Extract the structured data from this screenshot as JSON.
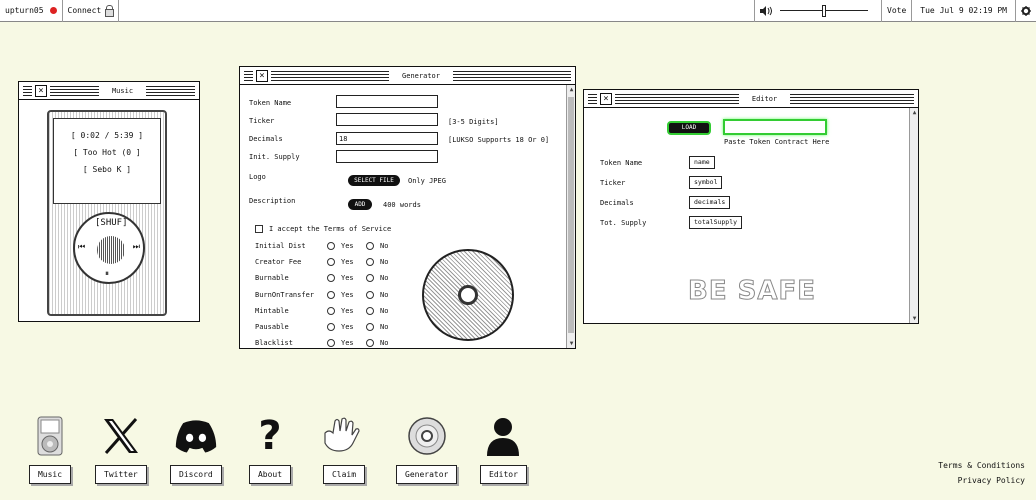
{
  "topbar": {
    "user": "upturn05",
    "connect_label": "Connect",
    "status_color": "#dd2222",
    "volume_level": 0.5,
    "vote_label": "Vote",
    "datetime": "Tue Jul 9 02:19 PM"
  },
  "music": {
    "title": "Music",
    "time": "[ 0:02 / 5:39 ]",
    "track": "[ Too Hot (0 ]",
    "artist": "[ Sebo K ]",
    "shuffle": "[SHUF]",
    "prev": "⏮",
    "next": "⏭",
    "pause": "⏸"
  },
  "generator": {
    "title": "Generator",
    "fields": [
      {
        "label": "Token Name",
        "value": "",
        "hint": ""
      },
      {
        "label": "Ticker",
        "value": "",
        "hint": "[3-5 Digits]"
      },
      {
        "label": "Decimals",
        "value": "18",
        "hint": "[LUKSO Supports 18 Or 0]"
      },
      {
        "label": "Init. Supply",
        "value": "",
        "hint": ""
      }
    ],
    "logo_label": "Logo",
    "select_file": "SELECT FILE",
    "logo_hint": "Only JPEG",
    "description_label": "Description",
    "add_label": "ADD",
    "description_hint": "400 words",
    "tos_label": "I accept the Terms of Service",
    "yes": "Yes",
    "no": "No",
    "options": [
      "Initial Dist",
      "Creator Fee",
      "Burnable",
      "BurnOnTransfer",
      "Mintable",
      "Pausable",
      "Blacklist"
    ]
  },
  "editor": {
    "title": "Editor",
    "load_label": "LOAD",
    "contract_value": "",
    "paste_hint": "Paste Token Contract Here",
    "rows": [
      {
        "label": "Token Name",
        "value": "name"
      },
      {
        "label": "Ticker",
        "value": "symbol"
      },
      {
        "label": "Decimals",
        "value": "decimals"
      },
      {
        "label": "Tot. Supply",
        "value": "totalSupply"
      }
    ],
    "banner": "BE SAFE"
  },
  "dock": [
    {
      "label": "Music",
      "icon": "ipod-icon"
    },
    {
      "label": "Twitter",
      "icon": "x-logo-icon"
    },
    {
      "label": "Discord",
      "icon": "discord-icon"
    },
    {
      "label": "About",
      "icon": "question-icon"
    },
    {
      "label": "Claim",
      "icon": "hand-icon"
    },
    {
      "label": "Generator",
      "icon": "disc-icon"
    },
    {
      "label": "Editor",
      "icon": "person-icon"
    }
  ],
  "footer": {
    "terms": "Terms & Conditions",
    "privacy": "Privacy Policy"
  }
}
